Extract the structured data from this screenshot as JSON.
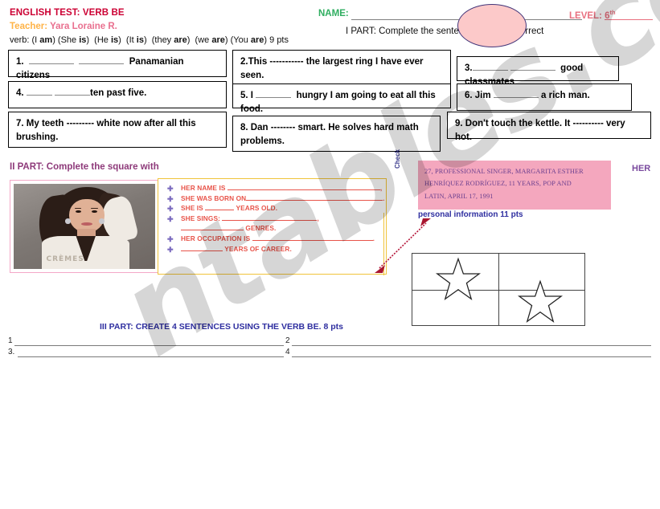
{
  "header": {
    "title": "ENGLISH TEST: VERB BE",
    "teacher_label": "Teacher:",
    "teacher_name": "Yara Loraine R.",
    "verb_line_prefix": "verb: (I ",
    "verb_line": "verb: (I am) (She is)  (He is)  (It is)  (they are)  (we are) (You are) 9 pts",
    "name_label": "NAME:",
    "level_label": "LEVEL: 6",
    "level_sup": "th",
    "part1_instruction": "I PART: Complete the sentences with the correct"
  },
  "part1": {
    "questions": [
      {
        "id": "q1",
        "number": "1.",
        "text_before": "",
        "blanks": [
          "lg",
          "lg"
        ],
        "text_after": "Panamanian citizens"
      },
      {
        "id": "q2",
        "number": "2.",
        "text": "2.This ----------- the largest ring I have ever seen."
      },
      {
        "id": "q3",
        "number": "3.",
        "text_after": "good classmates"
      },
      {
        "id": "q4",
        "number": "4.",
        "text_after": "ten past five."
      },
      {
        "id": "q5",
        "number": "5.",
        "text_before": "5. I",
        "text_after": "hungry I am going to eat all this food."
      },
      {
        "id": "q6",
        "number": "6.",
        "text_before": "6. Jim",
        "text_after": "a rich man."
      },
      {
        "id": "q7",
        "number": "7.",
        "text": "7. My teeth          --------- white now after all this brushing."
      },
      {
        "id": "q8",
        "number": "8.",
        "text": "8. Dan -------- smart. He solves hard math problems."
      },
      {
        "id": "q9",
        "number": "9.",
        "text": "9. Don't touch the kettle. It ---------- very hot."
      }
    ]
  },
  "part2": {
    "title": "II  PART:  Complete  the  square  with",
    "check_label": "Check",
    "her_label": "HER",
    "caption": "personal information 11 pts",
    "info_lines": [
      "27, PROFESSIONAL SINGER, MARGARITA ESTHER",
      "HENRÍQUEZ RODRÍGUEZ,        11 YEARS, POP AND",
      "LATIN, APRIL 17, 1991"
    ],
    "list_items": [
      {
        "text": "HER NAME IS",
        "rule": 190,
        "tail": ","
      },
      {
        "text": "SHE WAS BORN ON",
        "rule": 170,
        "tail": "."
      },
      {
        "text": "SHE IS",
        "rule": 36,
        "tail": " YEARS OLD."
      },
      {
        "text": "SHE SINGS:",
        "rule": 118,
        "tail": ","
      },
      {
        "text": "",
        "rule": 78,
        "tail": " GENRES.",
        "noglyph": true
      },
      {
        "text": "HER OCCUPATION IS",
        "rule": 150,
        "tail": "."
      },
      {
        "text": "",
        "rule": 52,
        "tail": " YEARS OF CAREER."
      }
    ],
    "photo_jacket_text": "CRÈMES"
  },
  "part3": {
    "title": "III PART: CREATE 4 SENTENCES USING THE VERB BE. 8 pts",
    "numbers": [
      "1",
      "2",
      "3.",
      "4"
    ]
  },
  "watermark": {
    "text": "ntables.com"
  },
  "colors": {
    "title_red": "#cc0033",
    "teacher_pink": "#e9708f",
    "name_green": "#2fae60",
    "level_pink": "#e8707f",
    "part2_purple": "#8e3a7a",
    "list_red": "#e8544a",
    "info_pink_bg": "#f4a7be",
    "info_text_purple": "#6b3f8f",
    "part3_blue": "#2f2fa0",
    "ellipse_pink": "#fcc9c9"
  }
}
